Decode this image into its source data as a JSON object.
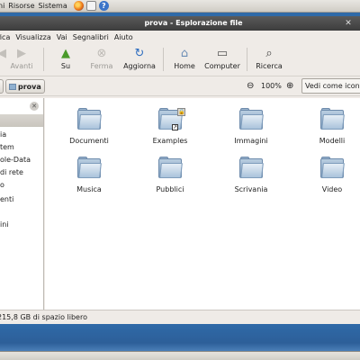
{
  "top_panel": {
    "menus": [
      "ni",
      "Risorse",
      "Sistema"
    ],
    "icons": [
      "firefox-icon",
      "mail-icon",
      "help-icon"
    ]
  },
  "window": {
    "title": "prova - Esplorazione file",
    "close_glyph": "✕"
  },
  "menubar": [
    "fica",
    "Visualizza",
    "Vai",
    "Segnalibri",
    "Aiuto"
  ],
  "toolbar": {
    "back": "Avanti",
    "up": "Su",
    "stop": "Ferma",
    "reload": "Aggiorna",
    "home": "Home",
    "computer": "Computer",
    "search": "Ricerca"
  },
  "location": {
    "crumb": "prova",
    "zoom": "100%",
    "view": "Vedi come icone"
  },
  "sidebar": {
    "items": [
      "ia",
      "tem",
      "ole-Data",
      "di rete",
      "o",
      "enti",
      "ini"
    ]
  },
  "files": [
    {
      "name": "Documenti"
    },
    {
      "name": "Examples"
    },
    {
      "name": "Immagini"
    },
    {
      "name": "Modelli"
    },
    {
      "name": "Musica"
    },
    {
      "name": "Pubblici"
    },
    {
      "name": "Scrivania"
    },
    {
      "name": "Video"
    }
  ],
  "status": "215,8 GB di spazio libero",
  "colors": {
    "desktop": "#2f6aa8",
    "titlebar": "#4a4a4a",
    "window_bg": "#efebe7"
  }
}
